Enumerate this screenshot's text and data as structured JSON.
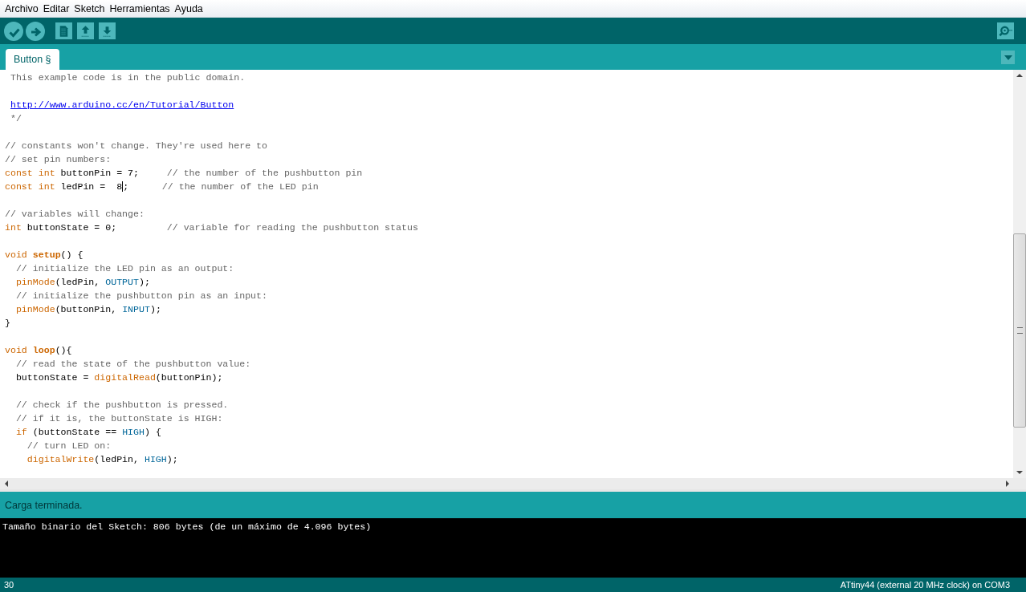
{
  "menu": [
    {
      "label": "Archivo"
    },
    {
      "label": "Editar"
    },
    {
      "label": "Sketch"
    },
    {
      "label": "Herramientas"
    },
    {
      "label": "Ayuda"
    }
  ],
  "toolbar": [
    {
      "kind": "verify"
    },
    {
      "kind": "upload"
    },
    {
      "kind": "new"
    },
    {
      "kind": "open"
    },
    {
      "kind": "save"
    }
  ],
  "tabs": [
    {
      "label": "Button §",
      "selected": true
    }
  ],
  "editor": {
    "lines": [
      {
        "tokens": [
          {
            "text": " This example code is in the public domain.",
            "kind": "comment"
          }
        ]
      },
      {
        "blank_before": true,
        "tokens": [
          {
            "text": " http://www.arduino.cc/en/Tutorial/Button",
            "kind": "link"
          }
        ]
      },
      {
        "tokens": [
          {
            "text": " */",
            "kind": "comment"
          }
        ]
      },
      {
        "blank_before": true,
        "tokens": [
          {
            "text": "// constants won't change. They're used here to",
            "kind": "comment"
          }
        ]
      },
      {
        "tokens": [
          {
            "text": "// set pin numbers:",
            "kind": "comment"
          }
        ]
      },
      {
        "tokens": [
          {
            "text": "const int",
            "kind": "keyword"
          },
          {
            "text": " buttonPin = 7;     ",
            "kind": "plain"
          },
          {
            "text": "// the number of the pushbutton pin",
            "kind": "comment"
          }
        ]
      },
      {
        "tokens": [
          {
            "text": "const int",
            "kind": "keyword"
          },
          {
            "text": " ledPin =  8",
            "kind": "plain"
          },
          {
            "kind": "caret"
          },
          {
            "text": ";      ",
            "kind": "plain"
          },
          {
            "text": "// the number of the LED pin",
            "kind": "comment"
          }
        ]
      },
      {
        "blank_before": true,
        "tokens": [
          {
            "text": "// variables will change:",
            "kind": "comment"
          }
        ]
      },
      {
        "tokens": [
          {
            "text": "int",
            "kind": "keyword"
          },
          {
            "text": " buttonState = 0;         ",
            "kind": "plain"
          },
          {
            "text": "// variable for reading the pushbutton status",
            "kind": "comment"
          }
        ]
      },
      {
        "blank_before": true,
        "tokens": [
          {
            "text": "void ",
            "kind": "keyword"
          },
          {
            "text": "setup",
            "kind": "builtin"
          },
          {
            "text": "() {",
            "kind": "plain"
          }
        ]
      },
      {
        "tokens": [
          {
            "text": "  // initialize the LED pin as an output:",
            "kind": "comment"
          }
        ]
      },
      {
        "tokens": [
          {
            "text": "  pinMode",
            "kind": "function"
          },
          {
            "text": "(ledPin, ",
            "kind": "plain"
          },
          {
            "text": "OUTPUT",
            "kind": "constant"
          },
          {
            "text": ");",
            "kind": "plain"
          }
        ]
      },
      {
        "tokens": [
          {
            "text": "  // initialize the pushbutton pin as an input:",
            "kind": "comment"
          }
        ]
      },
      {
        "tokens": [
          {
            "text": "  pinMode",
            "kind": "function"
          },
          {
            "text": "(buttonPin, ",
            "kind": "plain"
          },
          {
            "text": "INPUT",
            "kind": "constant"
          },
          {
            "text": ");",
            "kind": "plain"
          }
        ]
      },
      {
        "tokens": [
          {
            "text": "}",
            "kind": "plain"
          }
        ]
      },
      {
        "blank_before": true,
        "tokens": [
          {
            "text": "void ",
            "kind": "keyword"
          },
          {
            "text": "loop",
            "kind": "builtin"
          },
          {
            "text": "(){",
            "kind": "plain"
          }
        ]
      },
      {
        "tokens": [
          {
            "text": "  // read the state of the pushbutton value:",
            "kind": "comment"
          }
        ]
      },
      {
        "tokens": [
          {
            "text": "  buttonState = ",
            "kind": "plain"
          },
          {
            "text": "digitalRead",
            "kind": "function"
          },
          {
            "text": "(buttonPin);",
            "kind": "plain"
          }
        ]
      },
      {
        "blank_before": true,
        "tokens": [
          {
            "text": "  // check if the pushbutton is pressed.",
            "kind": "comment"
          }
        ]
      },
      {
        "tokens": [
          {
            "text": "  // if it is, the buttonState is HIGH:",
            "kind": "comment"
          }
        ]
      },
      {
        "tokens": [
          {
            "text": "  if",
            "kind": "keyword"
          },
          {
            "text": " (buttonState == ",
            "kind": "plain"
          },
          {
            "text": "HIGH",
            "kind": "constant"
          },
          {
            "text": ") {",
            "kind": "plain"
          }
        ]
      },
      {
        "tokens": [
          {
            "text": "    // turn LED on:",
            "kind": "comment"
          }
        ]
      },
      {
        "tokens": [
          {
            "text": "    digitalWrite",
            "kind": "function"
          },
          {
            "text": "(ledPin, ",
            "kind": "plain"
          },
          {
            "text": "HIGH",
            "kind": "constant"
          },
          {
            "text": ");",
            "kind": "plain"
          }
        ]
      }
    ]
  },
  "message": "Carga terminada.",
  "console": [
    "Tamaño binario del Sketch: 806 bytes (de un máximo de 4.096 bytes)"
  ],
  "status_bar": {
    "line": "30",
    "board": "ATtiny44 (external 20 MHz clock) on COM3"
  }
}
